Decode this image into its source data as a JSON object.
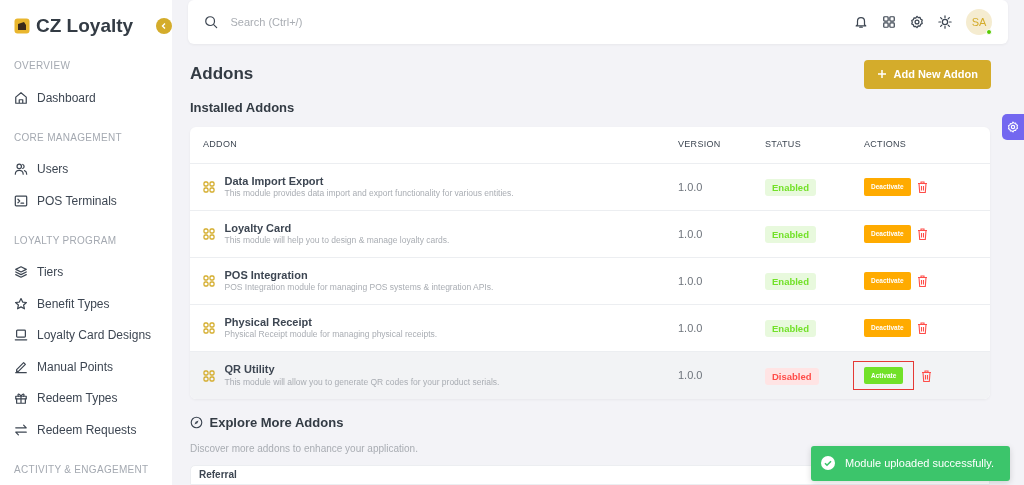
{
  "brand": {
    "name": "CZ Loyalty"
  },
  "sidebar": {
    "sections": [
      {
        "label": "OVERVIEW",
        "items": [
          {
            "label": "Dashboard"
          }
        ]
      },
      {
        "label": "CORE MANAGEMENT",
        "items": [
          {
            "label": "Users"
          },
          {
            "label": "POS Terminals"
          }
        ]
      },
      {
        "label": "LOYALTY PROGRAM",
        "items": [
          {
            "label": "Tiers"
          },
          {
            "label": "Benefit Types"
          },
          {
            "label": "Loyalty Card Designs"
          },
          {
            "label": "Manual Points"
          },
          {
            "label": "Redeem Types"
          },
          {
            "label": "Redeem Requests"
          }
        ]
      },
      {
        "label": "ACTIVITY & ENGAGEMENT"
      }
    ]
  },
  "topbar": {
    "search": {
      "placeholder": "Search (Ctrl+/)"
    },
    "avatar": {
      "initials": "SA",
      "online": true
    }
  },
  "page": {
    "title": "Addons",
    "add_button": "Add New Addon",
    "installed_title": "Installed Addons"
  },
  "table": {
    "columns": [
      "ADDON",
      "VERSION",
      "STATUS",
      "ACTIONS"
    ],
    "rows": [
      {
        "name": "Data Import Export",
        "description": "This module provides data import and export functionality for various entities.",
        "version": "1.0.0",
        "status": "Enabled",
        "enabled": true,
        "action": "Deactivate",
        "highlighted": false,
        "hovered": false
      },
      {
        "name": "Loyalty Card",
        "description": "This module will help you to design & manage loyalty cards.",
        "version": "1.0.0",
        "status": "Enabled",
        "enabled": true,
        "action": "Deactivate",
        "highlighted": false,
        "hovered": false
      },
      {
        "name": "POS Integration",
        "description": "POS Integration module for managing POS systems & integration APIs.",
        "version": "1.0.0",
        "status": "Enabled",
        "enabled": true,
        "action": "Deactivate",
        "highlighted": false,
        "hovered": false
      },
      {
        "name": "Physical Receipt",
        "description": "Physical Receipt module for managing physical receipts.",
        "version": "1.0.0",
        "status": "Enabled",
        "enabled": true,
        "action": "Deactivate",
        "highlighted": false,
        "hovered": false
      },
      {
        "name": "QR Utility",
        "description": "This module will allow you to generate QR codes for your product serials.",
        "version": "1.0.0",
        "status": "Disabled",
        "enabled": false,
        "action": "Activate",
        "highlighted": true,
        "hovered": true
      }
    ]
  },
  "explore": {
    "title": "Explore More Addons",
    "subtitle": "Discover more addons to enhance your application.",
    "cards": [
      {
        "name": "Referral"
      }
    ]
  },
  "toast": {
    "message": "Module uploaded successfully."
  }
}
